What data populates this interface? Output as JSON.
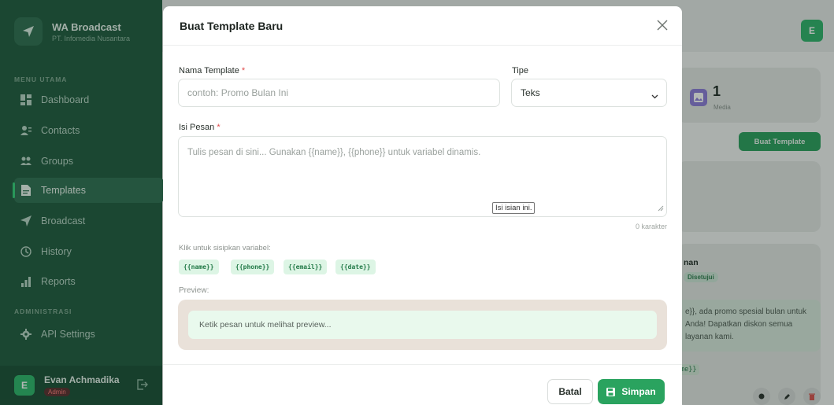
{
  "sidebar": {
    "brand_title": "WA Broadcast",
    "brand_subtitle": "PT. Infomedia Nusantara",
    "section_main": "MENU UTAMA",
    "section_admin": "ADMINISTRASI",
    "items": [
      {
        "label": "Dashboard",
        "icon": "dashboard-icon"
      },
      {
        "label": "Contacts",
        "icon": "contacts-icon"
      },
      {
        "label": "Groups",
        "icon": "groups-icon"
      },
      {
        "label": "Templates",
        "icon": "templates-icon",
        "active": true
      },
      {
        "label": "Broadcast",
        "icon": "send-icon"
      },
      {
        "label": "History",
        "icon": "clock-icon"
      },
      {
        "label": "Reports",
        "icon": "bar-chart-icon"
      },
      {
        "label": "API Settings",
        "icon": "gear-icon"
      }
    ],
    "user": {
      "initial": "E",
      "name": "Evan Achmadika",
      "role": "Admin"
    }
  },
  "background": {
    "user_initial": "E",
    "media_count": "1",
    "media_label": "Media",
    "create_button": "Buat Template",
    "card_title_fragment": "nan",
    "badge": "Disetujui",
    "message_fragment": "e}}, ada promo spesial bulan untuk Anda! Dapatkan diskon semua layanan kami.",
    "var_fragment": "me}}"
  },
  "modal": {
    "title": "Buat Template Baru",
    "name_label": "Nama Template",
    "name_placeholder": "contoh: Promo Bulan Ini",
    "type_label": "Tipe",
    "type_value": "Teks",
    "message_label": "Isi Pesan",
    "message_placeholder": "Tulis pesan di sini... Gunakan {{name}}, {{phone}} untuk variabel dinamis.",
    "tooltip": "Isi isian ini.",
    "char_count": "0 karakter",
    "variables_hint": "Klik untuk sisipkan variabel:",
    "variables": [
      "{{name}}",
      "{{phone}}",
      "{{email}}",
      "{{date}}"
    ],
    "preview_label": "Preview:",
    "preview_placeholder": "Ketik pesan untuk melihat preview...",
    "cancel_label": "Batal",
    "save_label": "Simpan"
  },
  "colors": {
    "sidebar_bg": "#1f5a3e",
    "accent": "#2aa35f",
    "required": "#e04a4a",
    "chip_bg": "#ddf5e5"
  }
}
